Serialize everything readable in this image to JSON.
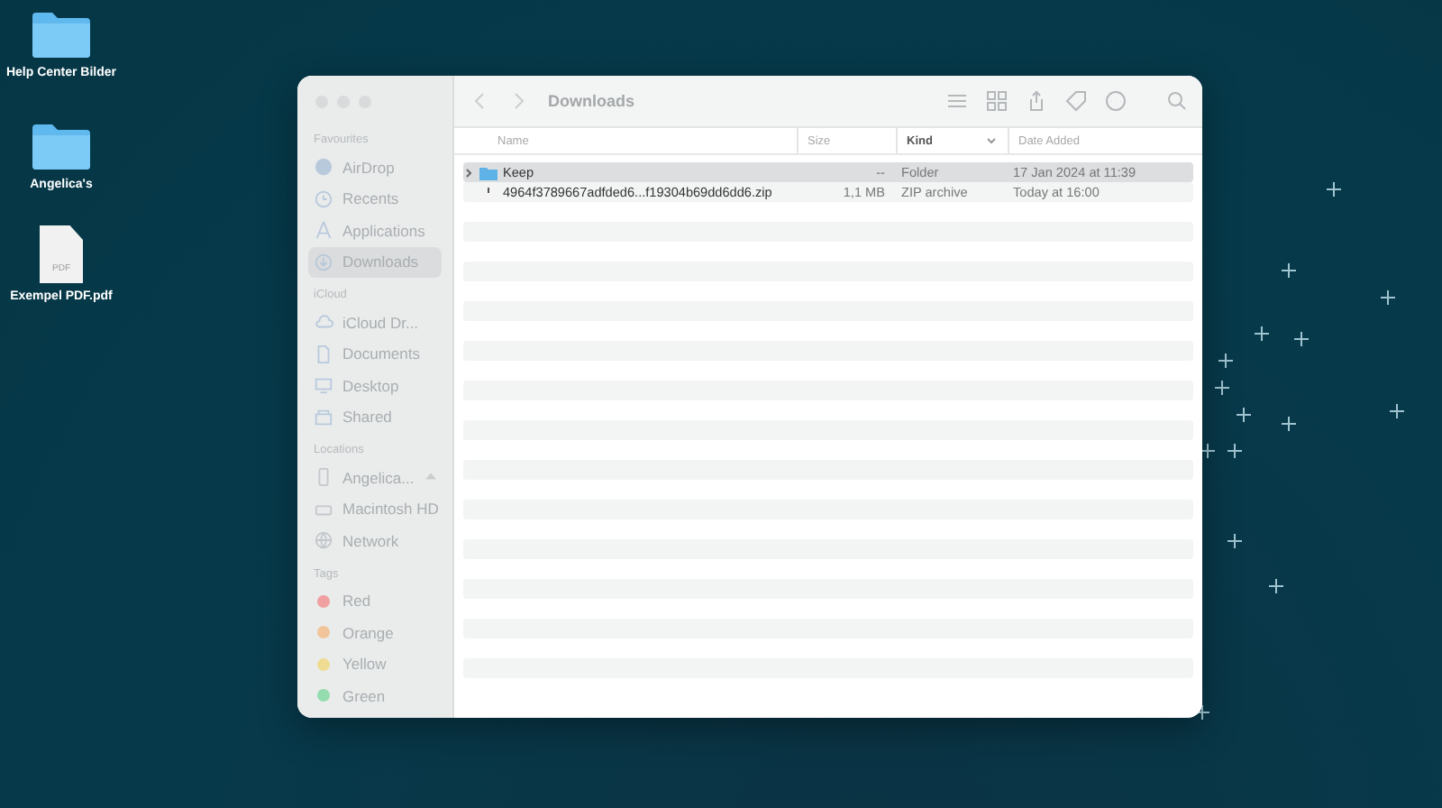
{
  "desktop_icons": [
    {
      "label": "Help Center Bilder",
      "kind": "folder"
    },
    {
      "label": "Angelica's",
      "kind": "folder"
    },
    {
      "label": "Exempel PDF.pdf",
      "kind": "pdf",
      "badge": "PDF"
    }
  ],
  "window": {
    "title": "Downloads",
    "sidebar": [
      {
        "heading": "Favourites",
        "items": [
          {
            "label": "AirDrop",
            "kind": "airdrop",
            "selected": false
          },
          {
            "label": "Recents",
            "kind": "clock",
            "selected": false
          },
          {
            "label": "Applications",
            "kind": "apps",
            "selected": false
          },
          {
            "label": "Downloads",
            "kind": "download",
            "selected": true
          }
        ]
      },
      {
        "heading": "iCloud",
        "items": [
          {
            "label": "iCloud Dr...",
            "kind": "cloud",
            "selected": false
          },
          {
            "label": "Documents",
            "kind": "doc",
            "selected": false
          },
          {
            "label": "Desktop",
            "kind": "desktop",
            "selected": false
          },
          {
            "label": "Shared",
            "kind": "shared",
            "selected": false
          }
        ]
      },
      {
        "heading": "Locations",
        "items": [
          {
            "label": "Angelica...",
            "kind": "phone",
            "selected": false,
            "eject": true
          },
          {
            "label": "Macintosh HD",
            "kind": "drive",
            "selected": false
          },
          {
            "label": "Network",
            "kind": "globe",
            "selected": false
          }
        ]
      },
      {
        "heading": "Tags",
        "items": [
          {
            "label": "Red",
            "kind": "tag",
            "color": "#f0a0a0",
            "selected": false
          },
          {
            "label": "Orange",
            "kind": "tag",
            "color": "#f2c49a",
            "selected": false
          },
          {
            "label": "Yellow",
            "kind": "tag",
            "color": "#efdc92",
            "selected": false
          },
          {
            "label": "Green",
            "kind": "tag",
            "color": "#94dcae",
            "selected": false
          }
        ]
      }
    ],
    "columns": [
      {
        "label": "Name",
        "sorted": false
      },
      {
        "label": "Size",
        "sorted": false
      },
      {
        "label": "Kind",
        "sorted": true
      },
      {
        "label": "Date Added",
        "sorted": false
      }
    ],
    "rows": [
      {
        "name": "Keep",
        "size": "--",
        "kind_column": "Folder",
        "date_added": "17 Jan 2024 at 11:39",
        "kind": "folder",
        "selected": true
      },
      {
        "name": "4964f3789667adfded6...f19304b69dd6dd6.zip",
        "size": "1,1 MB",
        "kind_column": "ZIP archive",
        "date_added": "Today at 16:00",
        "kind": "zip",
        "selected": false
      }
    ]
  }
}
